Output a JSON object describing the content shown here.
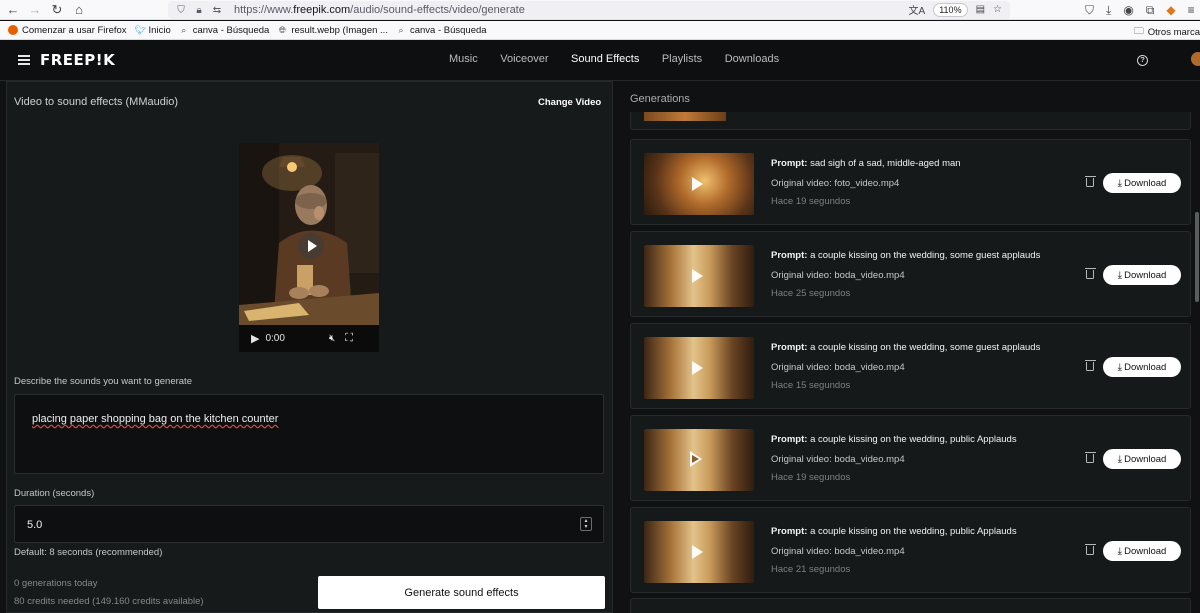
{
  "browser": {
    "url_prefix": "https://www.",
    "url_domain": "freepik.com",
    "url_path": "/audio/sound-effects/video/generate",
    "zoom": "110%",
    "bookmarks": [
      "Comenzar a usar Firefox",
      "Inicio",
      "canva - Búsqueda",
      "result.webp (Imagen ...",
      "canva - Búsqueda"
    ],
    "other_bookmarks": "Otros marca"
  },
  "header": {
    "logo": "FREEP!K",
    "nav": [
      "Music",
      "Voiceover",
      "Sound Effects",
      "Playlists",
      "Downloads"
    ],
    "active_nav": "Sound Effects",
    "help_icon": "?"
  },
  "left": {
    "title": "Video to sound effects (MMaudio)",
    "change_video": "Change Video",
    "video_time": "0:00",
    "describe_label": "Describe the sounds you want to generate",
    "prompt_text": "placing paper shopping bag on the kitchen counter",
    "duration_label": "Duration (seconds)",
    "duration_value": "5.0",
    "duration_default": "Default: 8 seconds (recommended)",
    "generations_today": "0 generations today",
    "credits": "80 credits needed (149.160 credits available)",
    "generate_button": "Generate sound effects"
  },
  "right": {
    "title": "Generations",
    "prompt_prefix": "Prompt:",
    "original_prefix": "Original video:",
    "download_label": "Download",
    "items": [
      {
        "prompt": "sad sigh of a sad, middle-aged man",
        "video": "foto_video.mp4",
        "time": "Hace 19 segundos",
        "thumb": "sigh"
      },
      {
        "prompt": "a couple kissing on the wedding, some guest applauds",
        "video": "boda_video.mp4",
        "time": "Hace 25 segundos",
        "thumb": "wed"
      },
      {
        "prompt": "a couple kissing on the wedding, some guest applauds",
        "video": "boda_video.mp4",
        "time": "Hace 15 segundos",
        "thumb": "wed"
      },
      {
        "prompt": "a couple kissing on the wedding, public Applauds",
        "video": "boda_video.mp4",
        "time": "Hace 19 segundos",
        "thumb": "wed"
      },
      {
        "prompt": "a couple kissing on the wedding, public Applauds",
        "video": "boda_video.mp4",
        "time": "Hace 21 segundos",
        "thumb": "wed"
      }
    ]
  }
}
